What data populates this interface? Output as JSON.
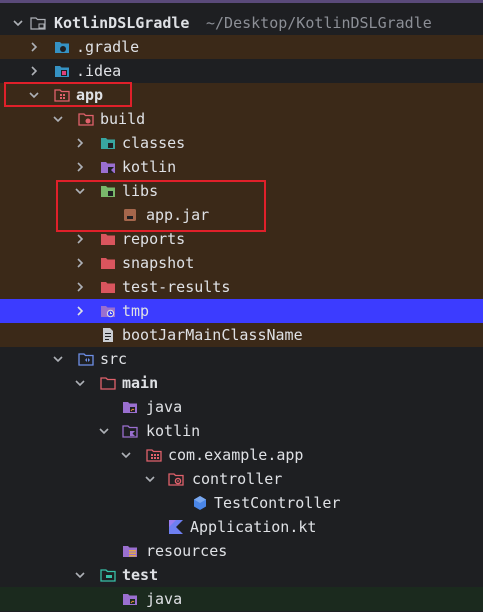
{
  "project": {
    "name": "KotlinDSLGradle",
    "path": "~/Desktop/KotlinDSLGradle"
  },
  "tree": {
    "gradle": ".gradle",
    "idea": ".idea",
    "app": "app",
    "build": "build",
    "classes": "classes",
    "kotlin_build": "kotlin",
    "libs": "libs",
    "app_jar": "app.jar",
    "reports": "reports",
    "snapshot": "snapshot",
    "test_results": "test-results",
    "tmp": "tmp",
    "boot_jar": "bootJarMainClassName",
    "src": "src",
    "main": "main",
    "java_main": "java",
    "kotlin_src": "kotlin",
    "package": "com.example.app",
    "controller": "controller",
    "test_controller": "TestController",
    "application": "Application.kt",
    "resources": "resources",
    "test": "test",
    "java_test": "java"
  },
  "colors": {
    "excluded_bg": "#3b2918",
    "selected_bg": "#3c3cff",
    "test_bg": "#1b2a1e",
    "highlight_box": "#e0202a"
  },
  "icons": {
    "folder": "folder-icon",
    "module": "module-folder-icon",
    "excluded": "excluded-folder-icon",
    "source_root": "source-root-icon",
    "test_root": "test-root-icon",
    "resources_root": "resources-root-icon",
    "package": "package-icon",
    "jar": "jar-icon",
    "text_file": "text-file-icon",
    "kotlin_file": "kotlin-file-icon",
    "kotlin_class": "kotlin-class-icon"
  }
}
